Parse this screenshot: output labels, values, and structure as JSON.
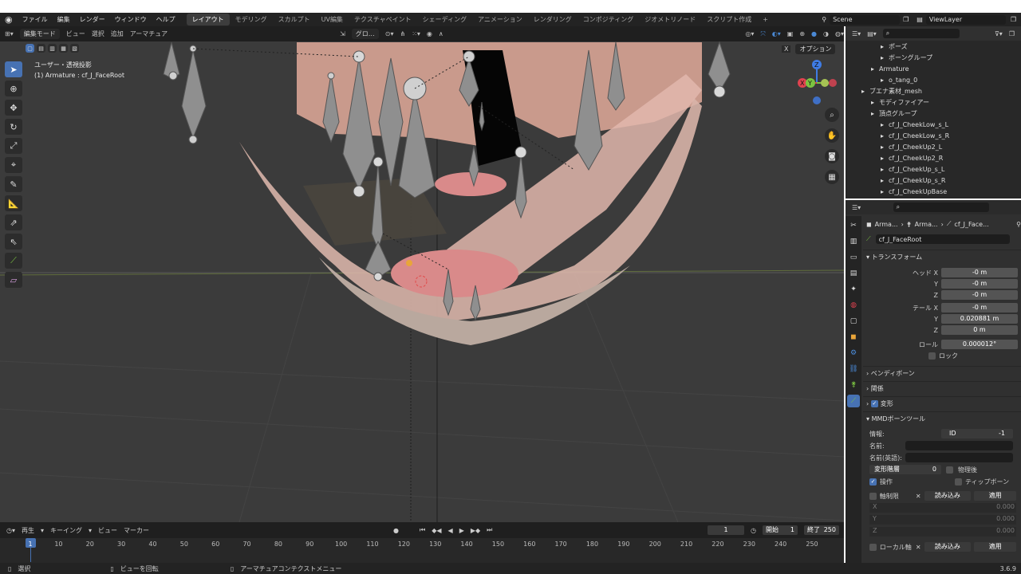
{
  "menu": [
    "ファイル",
    "編集",
    "レンダー",
    "ウィンドウ",
    "ヘルプ"
  ],
  "workspaces": [
    "レイアウト",
    "モデリング",
    "スカルプト",
    "UV編集",
    "テクスチャペイント",
    "シェーディング",
    "アニメーション",
    "レンダリング",
    "コンポジティング",
    "ジオメトリノード",
    "スクリプト作成"
  ],
  "add_tab": "+",
  "scene": "Scene",
  "view_layer": "ViewLayer",
  "viewport_header": {
    "mode": "編集モード",
    "view": "ビュー",
    "select": "選択",
    "add": "追加",
    "armature": "アーマチュア",
    "transform_orientation": "グロ…",
    "options": "オプション"
  },
  "overlay": {
    "view_name": "ユーザー・透視投影",
    "object": "(1) Armature : cf_J_FaceRoot"
  },
  "gizmo": {
    "x": "X",
    "y": "Y",
    "z": "Z"
  },
  "outliner": {
    "items": [
      {
        "label": "ポーズ",
        "indent": 3
      },
      {
        "label": "ボーングループ",
        "indent": 3
      },
      {
        "label": "Armature",
        "indent": 2
      },
      {
        "label": "o_tang_0",
        "indent": 3
      },
      {
        "label": "ブエナ素材_mesh",
        "indent": 1
      },
      {
        "label": "モディファイアー",
        "indent": 2
      },
      {
        "label": "頂点グループ",
        "indent": 2
      },
      {
        "label": "cf_J_CheekLow_s_L",
        "indent": 3
      },
      {
        "label": "cf_J_CheekLow_s_R",
        "indent": 3
      },
      {
        "label": "cf_J_CheekUp2_L",
        "indent": 3
      },
      {
        "label": "cf_J_CheekUp2_R",
        "indent": 3
      },
      {
        "label": "cf_J_CheekUp_s_L",
        "indent": 3
      },
      {
        "label": "cf_J_CheekUp_s_R",
        "indent": 3
      },
      {
        "label": "cf_J_CheekUpBase",
        "indent": 3
      },
      {
        "label": "cf_J_Chin_Base",
        "indent": 3
      }
    ]
  },
  "properties": {
    "breadcrumb": [
      "Arma...",
      "Arma...",
      "cf_J_Face..."
    ],
    "bone_name": "cf_J_FaceRoot",
    "transform_label": "トランスフォーム",
    "head_x_label": "ヘッド X",
    "head_x": "-0 m",
    "head_y_label": "Y",
    "head_y": "-0 m",
    "head_z_label": "Z",
    "head_z": "-0 m",
    "tail_x_label": "テール X",
    "tail_x": "-0 m",
    "tail_y_label": "Y",
    "tail_y": "0.020881 m",
    "tail_z_label": "Z",
    "tail_z": "0 m",
    "roll_label": "ロール",
    "roll": "0.000012°",
    "lock_label": "ロック",
    "bendy_label": "ベンディボーン",
    "relations_label": "関係",
    "deform_label": "変形",
    "mmd_label": "MMDボーンツール",
    "info_label": "情報:",
    "id_label": "ID",
    "id_value": "-1",
    "name_label": "名前:",
    "name_en_label": "名前(英語):",
    "deform_layer_label": "変形階層",
    "deform_layer": "0",
    "after_physics_label": "物理後",
    "operate_label": "操作",
    "tip_bone_label": "ティップボーン",
    "axis_limit_label": "軸制限",
    "load_label": "読み込み",
    "apply_label": "適用",
    "ax_x": "X",
    "ax_y": "Y",
    "ax_z": "Z",
    "ax_val": "0.000",
    "local_axis_label": "ローカル軸"
  },
  "timeline": {
    "play": "再生",
    "keying": "キーイング",
    "view": "ビュー",
    "marker": "マーカー",
    "current_frame": "1",
    "start_label": "開始",
    "start": "1",
    "end_label": "終了",
    "end": "250",
    "ticks": [
      "1",
      "10",
      "20",
      "30",
      "40",
      "50",
      "60",
      "70",
      "80",
      "90",
      "100",
      "110",
      "120",
      "130",
      "140",
      "150",
      "160",
      "170",
      "180",
      "190",
      "200",
      "210",
      "220",
      "230",
      "240",
      "250"
    ]
  },
  "status": {
    "select": "選択",
    "rotate": "ビューを回転",
    "context": "アーマチュアコンテクストメニュー",
    "version": "3.6.9"
  },
  "colors": {
    "accent": "#4772b3",
    "x_axis": "#e0424f",
    "y_axis": "#7bc341",
    "z_axis": "#3f7ce5",
    "mouth": "#d98a8a",
    "skin": "#c4a79a"
  }
}
